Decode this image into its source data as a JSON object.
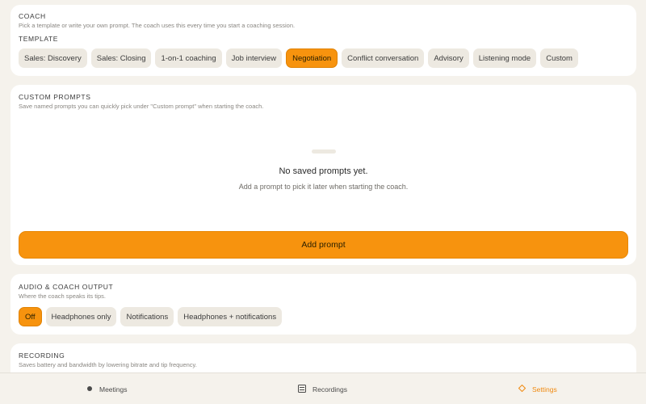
{
  "coach": {
    "title": "COACH",
    "description": "Pick a template or write your own prompt. The coach uses this every time you start a coaching session.",
    "template_label": "TEMPLATE",
    "templates": [
      {
        "label": "Sales: Discovery",
        "active": false
      },
      {
        "label": "Sales: Closing",
        "active": false
      },
      {
        "label": "1-on-1 coaching",
        "active": false
      },
      {
        "label": "Job interview",
        "active": false
      },
      {
        "label": "Negotiation",
        "active": true
      },
      {
        "label": "Conflict conversation",
        "active": false
      },
      {
        "label": "Advisory",
        "active": false
      },
      {
        "label": "Listening mode",
        "active": false
      },
      {
        "label": "Custom",
        "active": false
      }
    ]
  },
  "custom_prompts": {
    "title": "CUSTOM PROMPTS",
    "description": "Save named prompts you can quickly pick under \"Custom prompt\" when starting the coach.",
    "empty_title": "No saved prompts yet.",
    "empty_subtitle": "Add a prompt to pick it later when starting the coach.",
    "add_button": "Add prompt"
  },
  "audio": {
    "title": "AUDIO & COACH OUTPUT",
    "description": "Where the coach speaks its tips.",
    "options": [
      {
        "label": "Off",
        "active": true
      },
      {
        "label": "Headphones only",
        "active": false
      },
      {
        "label": "Notifications",
        "active": false
      },
      {
        "label": "Headphones + notifications",
        "active": false
      }
    ]
  },
  "recording": {
    "title": "RECORDING",
    "description": "Saves battery and bandwidth by lowering bitrate and tip frequency."
  },
  "tabbar": {
    "items": [
      {
        "label": "Meetings",
        "icon": "dot-icon",
        "active": false
      },
      {
        "label": "Recordings",
        "icon": "list-icon",
        "active": false
      },
      {
        "label": "Settings",
        "icon": "diamond-icon",
        "active": true
      }
    ]
  },
  "colors": {
    "accent": "#f7930e",
    "background": "#f5f2ec",
    "chip": "#ede9e1"
  }
}
